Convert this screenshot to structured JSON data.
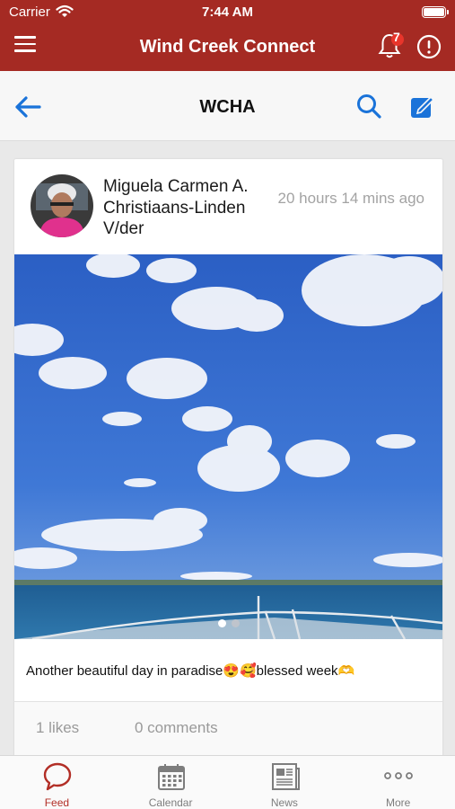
{
  "status_bar": {
    "carrier": "Carrier",
    "time": "7:44 AM"
  },
  "header": {
    "title": "Wind Creek Connect",
    "notification_count": "7",
    "accent_color": "#a52a23"
  },
  "subnav": {
    "title": "WCHA",
    "icon_color": "#1a73d9"
  },
  "post": {
    "author": "Miguela Carmen A. Christiaans-Linden V/der",
    "timestamp": "20 hours 14 mins ago",
    "caption": "Another beautiful day in paradise😍🥰blessed week🫶",
    "image_pages": 2,
    "image_current_page": 1,
    "likes": "1 likes",
    "comments": "0 comments"
  },
  "tabs": [
    {
      "label": "Feed",
      "icon": "chat-bubble-icon",
      "active": true
    },
    {
      "label": "Calendar",
      "icon": "calendar-icon",
      "active": false
    },
    {
      "label": "News",
      "icon": "newspaper-icon",
      "active": false
    },
    {
      "label": "More",
      "icon": "more-dots-icon",
      "active": false
    }
  ]
}
